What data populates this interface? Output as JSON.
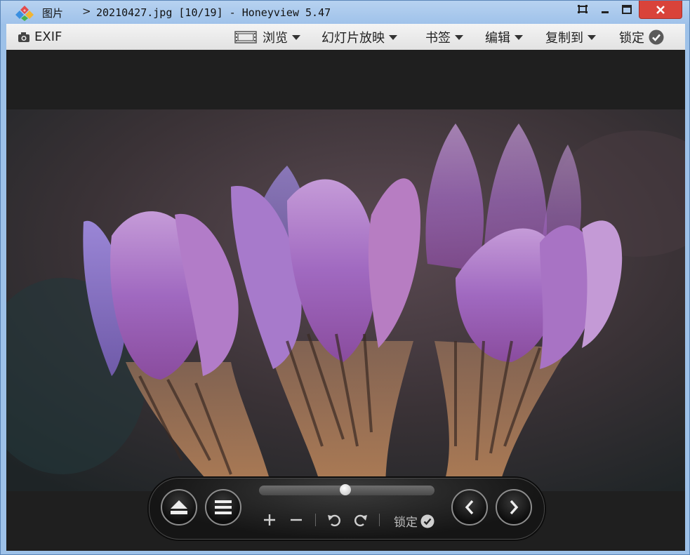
{
  "window": {
    "folder": "图片",
    "separator": ">",
    "title": "20210427.jpg [10/19] - Honeyview 5.47"
  },
  "toolbar": {
    "exif_label": "EXIF",
    "browse_label": "浏览",
    "slideshow_label": "幻灯片放映",
    "bookmark_label": "书签",
    "edit_label": "编辑",
    "copyto_label": "复制到",
    "lock_label": "锁定"
  },
  "controls": {
    "lock_label": "锁定",
    "zoom_progress": 0.49
  },
  "colors": {
    "titlebar": "#a9c9ee",
    "close_button": "#d9433a",
    "viewer_bg": "#1f1f1f",
    "toolbar_bg": "#ececec"
  },
  "icons": [
    "app-logo-icon",
    "restore-icon",
    "minimize-icon",
    "maximize-icon",
    "close-icon",
    "camera-icon",
    "film-icon",
    "caret-down-icon",
    "check-circle-icon",
    "eject-icon",
    "menu-icon",
    "zoom-in-icon",
    "zoom-out-icon",
    "rotate-left-icon",
    "rotate-right-icon",
    "previous-icon",
    "next-icon"
  ]
}
